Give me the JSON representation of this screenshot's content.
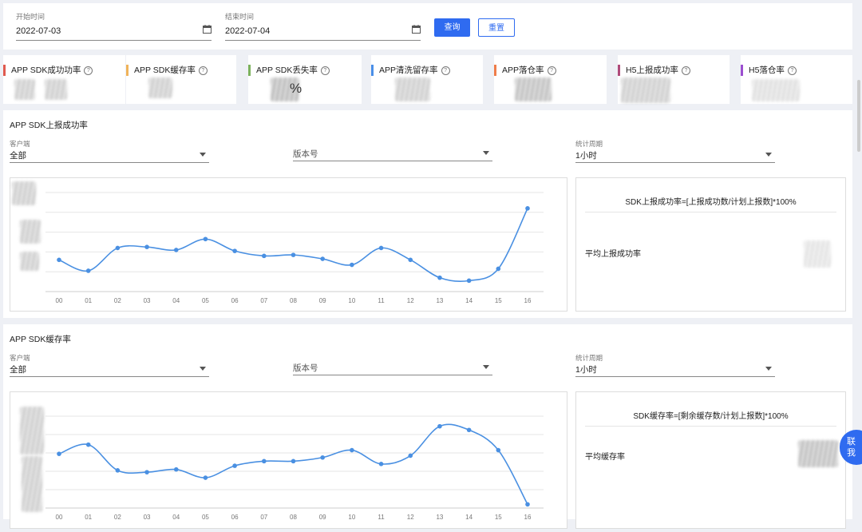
{
  "filters": {
    "start": {
      "label": "开始时间",
      "value": "2022-07-03"
    },
    "end": {
      "label": "结束时间",
      "value": "2022-07-04"
    },
    "query_label": "查询",
    "reset_label": "重置"
  },
  "metrics": [
    {
      "title": "APP SDK成功功率",
      "color": "#e05a4f"
    },
    {
      "title": "APP SDK缓存率",
      "color": "#f0b35a"
    },
    {
      "title": "APP SDK丢失率",
      "color": "#7cb25c",
      "value": "%"
    },
    {
      "title": "APP清洗留存率",
      "color": "#4a8fe8"
    },
    {
      "title": "APP落仓率",
      "color": "#ef7d4a"
    },
    {
      "title": "H5上报成功率",
      "color": "#b04a7a"
    },
    {
      "title": "H5落仓率",
      "color": "#9b4fd0"
    }
  ],
  "colors": {
    "accent": "#2f6bf0",
    "line": "#4a90e2"
  },
  "sections": [
    {
      "title": "APP SDK上报成功率",
      "client": {
        "label": "客户端",
        "value": "全部"
      },
      "version": {
        "placeholder": "版本号"
      },
      "period": {
        "label": "统计周期",
        "value": "1小时"
      },
      "formula": "SDK上报成功率=[上报成功数/计划上报数]*100%",
      "avg_label": "平均上报成功率"
    },
    {
      "title": "APP SDK缓存率",
      "client": {
        "label": "客户端",
        "value": "全部"
      },
      "version": {
        "placeholder": "版本号"
      },
      "period": {
        "label": "统计周期",
        "value": "1小时"
      },
      "formula": "SDK缓存率=[剩余缓存数/计划上报数]*100%",
      "avg_label": "平均缓存率"
    }
  ],
  "float_button": {
    "line1": "联",
    "line2": "我"
  },
  "chart_data": [
    {
      "type": "line",
      "title": "APP SDK上报成功率",
      "x": [
        "00",
        "01",
        "02",
        "03",
        "04",
        "05",
        "06",
        "07",
        "08",
        "09",
        "10",
        "11",
        "12",
        "13",
        "14",
        "15",
        "16"
      ],
      "series": [
        {
          "values": [
            32,
            21,
            44,
            45,
            42,
            53,
            41,
            36,
            37,
            33,
            27,
            44,
            32,
            14,
            11,
            23,
            84
          ]
        }
      ],
      "ylim": [
        0,
        100
      ],
      "grid": true,
      "y_tick_labels_visible": false
    },
    {
      "type": "line",
      "title": "APP SDK缓存率",
      "x": [
        "00",
        "01",
        "02",
        "03",
        "04",
        "05",
        "06",
        "07",
        "08",
        "09",
        "10",
        "11",
        "12",
        "13",
        "14",
        "15",
        "16"
      ],
      "series": [
        {
          "values": [
            59,
            69,
            41,
            39,
            42,
            33,
            46,
            51,
            51,
            55,
            63,
            48,
            57,
            89,
            85,
            63,
            4
          ]
        }
      ],
      "ylim": [
        0,
        100
      ],
      "grid": true,
      "y_tick_labels_visible": false
    }
  ]
}
